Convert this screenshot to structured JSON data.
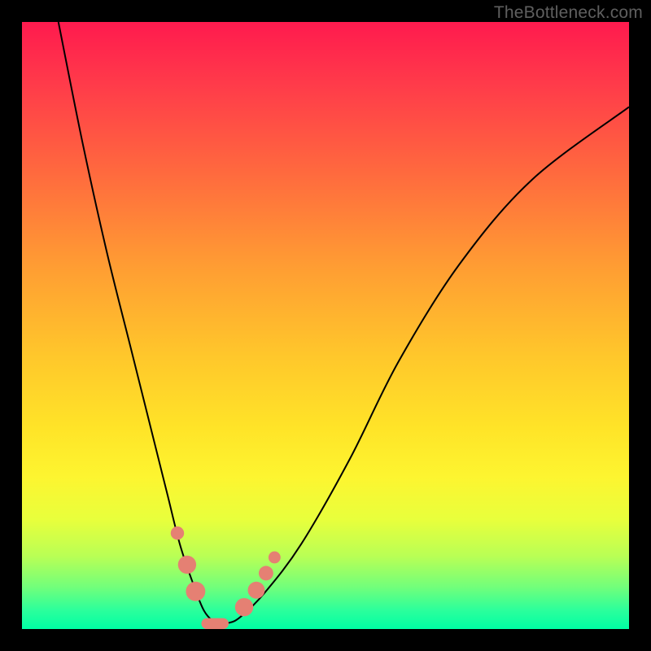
{
  "watermark": "TheBottleneck.com",
  "colors": {
    "gradient_top": "#ff1a4e",
    "gradient_mid": "#ffe428",
    "gradient_bottom": "#00ffa4",
    "curve": "#000000",
    "beads": "#e58073",
    "frame": "#000000"
  },
  "chart_data": {
    "type": "line",
    "title": "",
    "xlabel": "",
    "ylabel": "",
    "xlim": [
      0,
      100
    ],
    "ylim": [
      0,
      100
    ],
    "note": "Stylized V-shaped bottleneck curve on a red-to-green gradient. No axes, ticks, or labels are shown. X and Y normalized 0–100; y≈0 corresponds to the green band at bottom (minimum bottleneck), y≈100 is the red top.",
    "series": [
      {
        "name": "bottleneck-curve",
        "x": [
          6,
          10,
          14,
          18,
          22,
          24,
          26,
          28,
          30,
          32,
          34,
          36,
          40,
          46,
          54,
          62,
          72,
          84,
          100
        ],
        "y": [
          100,
          80,
          62,
          46,
          30,
          22,
          14,
          8,
          3,
          1,
          1,
          2,
          6,
          14,
          28,
          44,
          60,
          74,
          86
        ]
      }
    ],
    "markers": [
      {
        "name": "left-bead-1",
        "x": 25.6,
        "y": 15.8,
        "r": 1.1
      },
      {
        "name": "left-bead-2",
        "x": 27.2,
        "y": 10.6,
        "r": 1.5
      },
      {
        "name": "left-bead-3",
        "x": 28.6,
        "y": 6.2,
        "r": 1.6
      },
      {
        "name": "trough-pill",
        "x": 31.8,
        "y": 0.9,
        "w": 4.5,
        "h": 1.8
      },
      {
        "name": "right-bead-1",
        "x": 36.6,
        "y": 3.6,
        "r": 1.5
      },
      {
        "name": "right-bead-2",
        "x": 38.6,
        "y": 6.4,
        "r": 1.4
      },
      {
        "name": "right-bead-3",
        "x": 40.2,
        "y": 9.2,
        "r": 1.2
      },
      {
        "name": "right-bead-4",
        "x": 41.6,
        "y": 11.8,
        "r": 1.0
      }
    ]
  }
}
